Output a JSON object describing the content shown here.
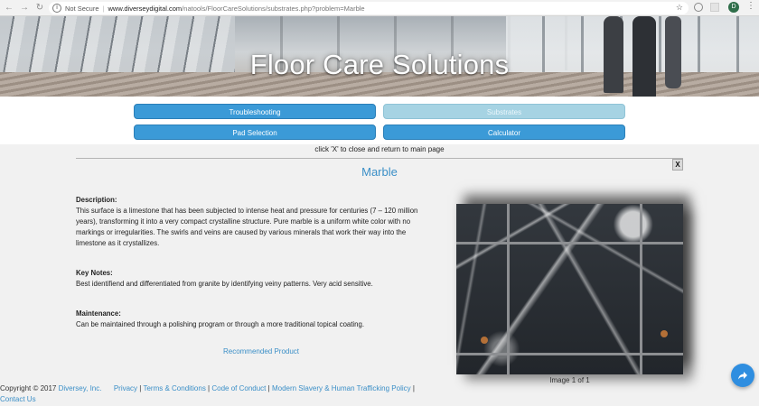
{
  "browser": {
    "security_label": "Not Secure",
    "url_host": "www.diverseydigital.com",
    "url_path": "/natools/FloorCareSolutions/substrates.php?problem=Marble",
    "profile_initial": "D"
  },
  "hero": {
    "title": "Floor Care Solutions"
  },
  "nav": {
    "troubleshooting": "Troubleshooting",
    "substrates": "Substrates",
    "pad_selection": "Pad Selection",
    "calculator": "Calculator"
  },
  "close_hint": "click 'X' to close and return to main page",
  "close_button": "X",
  "page_title": "Marble",
  "description": {
    "heading": "Description:",
    "text": "This surface is a limestone that has been subjected to intense heat and pressure for centuries (7 – 120 million years), transforming it into a very compact crystalline structure. Pure marble is a uniform white color with no markings or irregularities. The swirls and veins are caused by various minerals that work their way into the limestone as it crystallizes."
  },
  "key_notes": {
    "heading": "Key Notes:",
    "text": "Best identifiend and differentiated from granite by identifying veiny patterns. Very acid sensitive."
  },
  "maintenance": {
    "heading": "Maintenance:",
    "text": "Can be maintained through a polishing program or through a more traditional topical coating."
  },
  "recommended_link": "Recommended Product",
  "image_caption": "Image 1 of 1",
  "footer": {
    "copyright": "Copyright © 2017",
    "company": "Diversey, Inc.",
    "privacy": "Privacy",
    "terms": "Terms & Conditions",
    "code": "Code of Conduct",
    "slavery": "Modern Slavery & Human Trafficking Policy",
    "contact": "Contact Us"
  },
  "colors": {
    "accent": "#3b9ad7",
    "link": "#3b8fc7",
    "disabled_button": "#a6d3e3"
  }
}
